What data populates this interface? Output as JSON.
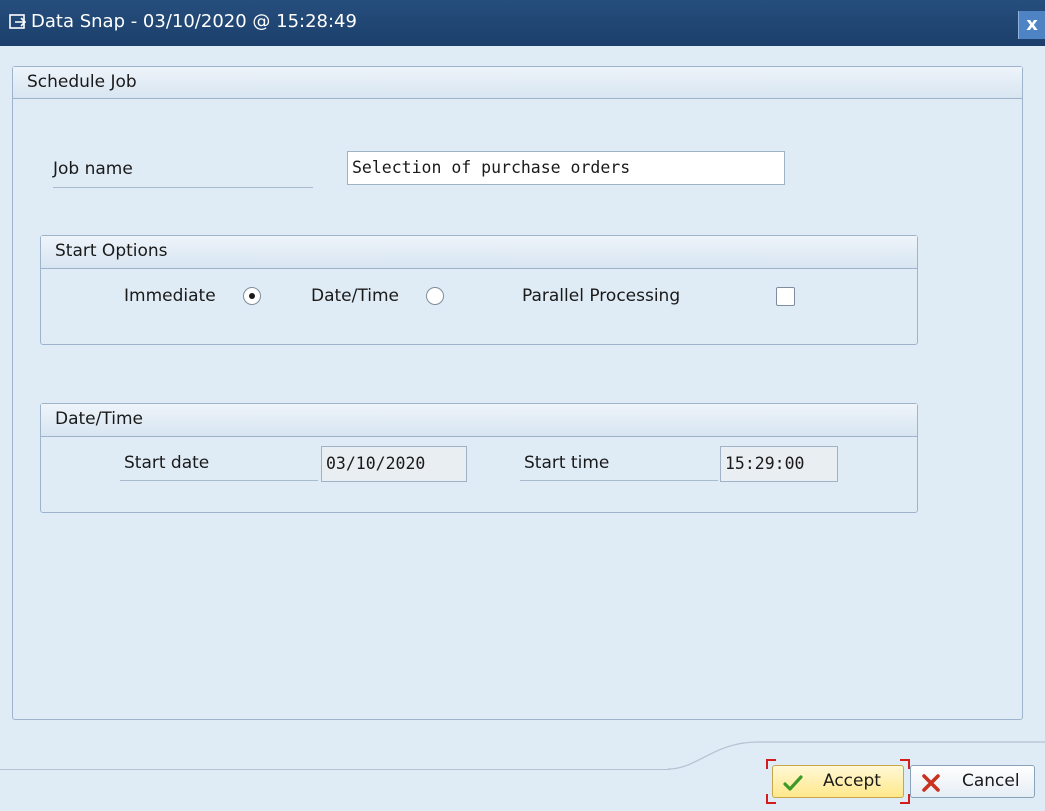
{
  "window": {
    "title": "Data Snap - 03/10/2020 @ 15:28:49",
    "close_label": "x"
  },
  "schedule_job": {
    "title": "Schedule Job",
    "job_name_label": "Job name",
    "job_name_value": "Selection of purchase orders"
  },
  "start_options": {
    "title": "Start Options",
    "immediate_label": "Immediate",
    "immediate_selected": true,
    "datetime_label": "Date/Time",
    "datetime_selected": false,
    "parallel_label": "Parallel Processing",
    "parallel_checked": false
  },
  "date_time": {
    "title": "Date/Time",
    "start_date_label": "Start date",
    "start_date_value": "03/10/2020",
    "start_time_label": "Start time",
    "start_time_value": "15:29:00"
  },
  "footer": {
    "accept_label": "Accept",
    "cancel_label": "Cancel"
  },
  "colors": {
    "titlebar": "#1b3f6b",
    "background": "#dfebf5",
    "accept_icon": "#3d9a28",
    "cancel_icon": "#c8321e"
  }
}
